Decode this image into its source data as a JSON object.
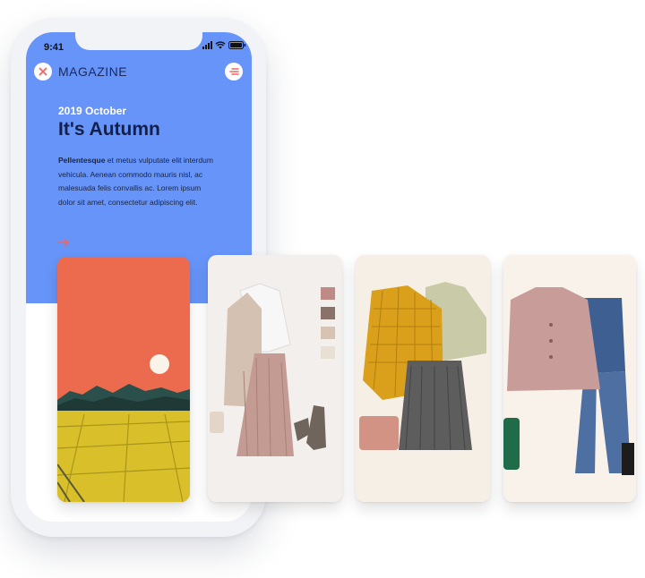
{
  "status_bar": {
    "time": "9:41"
  },
  "header": {
    "title": "MAGAZINE",
    "close_icon": "close-icon",
    "menu_icon": "menu-icon"
  },
  "article": {
    "date": "2019 October",
    "title": "It's Autumn",
    "lead_bold": "Pellentesque",
    "lead_rest": " et metus vulputate elit interdum vehicula. Aenean commodo mauris nisl, ac malesuada felis convallis ac. Lorem ipsum dolor sit amet, consectetur adipiscing elit.",
    "arrow_icon": "arrow-right-icon"
  },
  "cards": [
    {
      "name": "autumn-landscape"
    },
    {
      "name": "outfit-beige-blazer",
      "swatches": [
        "#bd8a86",
        "#8a716a",
        "#d8c3b3",
        "#e8e0d2"
      ]
    },
    {
      "name": "outfit-yellow-jacket"
    },
    {
      "name": "outfit-pink-coat"
    }
  ],
  "colors": {
    "accent": "#6694f8",
    "accent_red": "#ef6464",
    "headline": "#13204a"
  }
}
